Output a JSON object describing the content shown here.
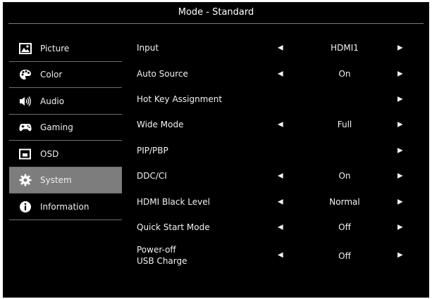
{
  "header": {
    "title": "Mode - Standard"
  },
  "sidebar": {
    "items": [
      {
        "label": "Picture",
        "icon": "picture-icon",
        "selected": false
      },
      {
        "label": "Color",
        "icon": "palette-icon",
        "selected": false
      },
      {
        "label": "Audio",
        "icon": "speaker-icon",
        "selected": false
      },
      {
        "label": "Gaming",
        "icon": "gamepad-icon",
        "selected": false
      },
      {
        "label": "OSD",
        "icon": "osd-icon",
        "selected": false
      },
      {
        "label": "System",
        "icon": "gear-icon",
        "selected": true
      },
      {
        "label": "Information",
        "icon": "info-icon",
        "selected": false
      }
    ]
  },
  "settings": [
    {
      "label": "Input",
      "value": "HDMI1",
      "left_arrow": "◀",
      "right_arrow": "▶"
    },
    {
      "label": "Auto Source",
      "value": "On",
      "left_arrow": "◀",
      "right_arrow": "▶"
    },
    {
      "label": "Hot Key Assignment",
      "value": "",
      "left_arrow": "",
      "right_arrow": "▶"
    },
    {
      "label": "Wide Mode",
      "value": "Full",
      "left_arrow": "◀",
      "right_arrow": "▶"
    },
    {
      "label": "PIP/PBP",
      "value": "",
      "left_arrow": "",
      "right_arrow": "▶"
    },
    {
      "label": "DDC/CI",
      "value": "On",
      "left_arrow": "◀",
      "right_arrow": "▶"
    },
    {
      "label": "HDMI Black Level",
      "value": "Normal",
      "left_arrow": "◀",
      "right_arrow": "▶"
    },
    {
      "label": "Quick Start Mode",
      "value": "Off",
      "left_arrow": "◀",
      "right_arrow": "▶"
    },
    {
      "label_line1": "Power-off",
      "label_line2": "USB Charge",
      "value": "Off",
      "left_arrow": "◀",
      "right_arrow": "▶"
    }
  ],
  "colors": {
    "background": "#000000",
    "selected": "#7d7d7d",
    "divider": "#6e6e6e",
    "text": "#f2f2f2"
  }
}
